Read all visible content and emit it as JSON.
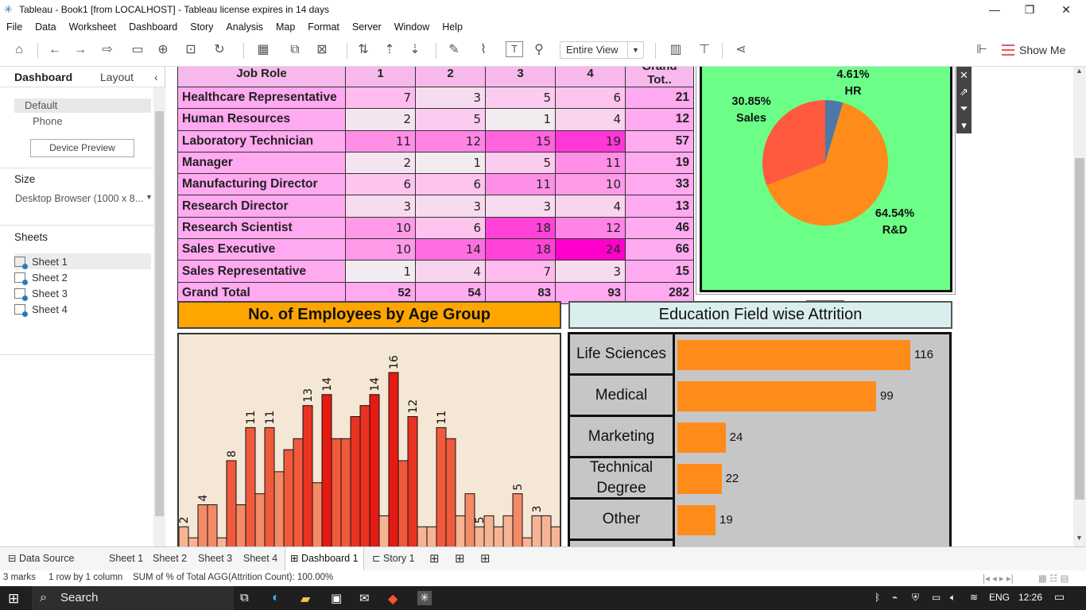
{
  "window": {
    "title": "Tableau - Book1 [from LOCALHOST] - Tableau license expires in 14 days",
    "minimize": "—",
    "restore": "❐",
    "close": "✕"
  },
  "menu": [
    "File",
    "Data",
    "Worksheet",
    "Dashboard",
    "Story",
    "Analysis",
    "Map",
    "Format",
    "Server",
    "Window",
    "Help"
  ],
  "toolbar": {
    "fit_value": "Entire View",
    "show_me": "Show Me"
  },
  "left_panel": {
    "tab_dashboard": "Dashboard",
    "tab_layout": "Layout",
    "collapse": "‹",
    "device_default": "Default",
    "device_phone": "Phone",
    "device_preview_button": "Device Preview",
    "size_title": "Size",
    "size_value": "Desktop Browser (1000 x 8...",
    "sheets_title": "Sheets",
    "sheets": [
      "Sheet 1",
      "Sheet 2",
      "Sheet 3",
      "Sheet 4"
    ]
  },
  "heat_table": {
    "headers": [
      "Job Role",
      "1",
      "2",
      "3",
      "4",
      "Grand Tot.."
    ],
    "rows": [
      {
        "role": "Healthcare Representative",
        "values": [
          7,
          3,
          5,
          6
        ],
        "total": 21
      },
      {
        "role": "Human Resources",
        "values": [
          2,
          5,
          1,
          4
        ],
        "total": 12
      },
      {
        "role": "Laboratory Technician",
        "values": [
          11,
          12,
          15,
          19
        ],
        "total": 57
      },
      {
        "role": "Manager",
        "values": [
          2,
          1,
          5,
          11
        ],
        "total": 19
      },
      {
        "role": "Manufacturing Director",
        "values": [
          6,
          6,
          11,
          10
        ],
        "total": 33
      },
      {
        "role": "Research Director",
        "values": [
          3,
          3,
          3,
          4
        ],
        "total": 13
      },
      {
        "role": "Research Scientist",
        "values": [
          10,
          6,
          18,
          12
        ],
        "total": 46
      },
      {
        "role": "Sales Executive",
        "values": [
          10,
          14,
          18,
          24
        ],
        "total": 66
      },
      {
        "role": "Sales Representative",
        "values": [
          1,
          4,
          7,
          3
        ],
        "total": 15
      },
      {
        "role": "Grand Total",
        "values": [
          52,
          54,
          83,
          93
        ],
        "total": 282
      }
    ]
  },
  "pie": {
    "slices": [
      {
        "pct_label": "4.61%",
        "name": "HR",
        "value": 4.61,
        "color": "#4e79a7"
      },
      {
        "pct_label": "64.54%",
        "name": "R&D",
        "value": 64.54,
        "color": "#ff8c1a"
      },
      {
        "pct_label": "30.85%",
        "name": "Sales",
        "value": 30.85,
        "color": "#ff5a3d"
      }
    ]
  },
  "age_chart": {
    "title": "No. of Employees by Age Group"
  },
  "edu_chart": {
    "title": "Education Field wise Attrition",
    "items": [
      {
        "label": "Life Sciences",
        "value": 116
      },
      {
        "label": "Medical",
        "value": 99
      },
      {
        "label": "Marketing",
        "value": 24
      },
      {
        "label": "Technical Degree",
        "value": 22
      },
      {
        "label": "Other",
        "value": 19
      }
    ]
  },
  "chart_data": [
    {
      "type": "bar",
      "title": "No. of Employees by Age Group",
      "values": [
        2,
        1,
        4,
        4,
        1,
        8,
        4,
        11,
        5,
        11,
        7,
        9,
        10,
        13,
        6,
        14,
        10,
        10,
        12,
        13,
        14,
        3,
        16,
        8,
        12,
        2,
        2,
        11,
        10,
        3,
        5,
        2,
        3,
        2,
        3,
        5,
        1,
        3,
        3,
        2,
        2
      ],
      "data_labels": {
        "0": "2",
        "2": "4",
        "5": "8",
        "7": "11",
        "9": "11",
        "13": "13",
        "15": "14",
        "20": "14",
        "22": "16",
        "24": "12",
        "27": "11",
        "31": "5",
        "35": "5",
        "37": "3",
        "40": "2"
      }
    },
    {
      "type": "bar",
      "title": "Education Field wise Attrition",
      "categories": [
        "Life Sciences",
        "Medical",
        "Marketing",
        "Technical Degree",
        "Other"
      ],
      "values": [
        116,
        99,
        24,
        22,
        19
      ]
    },
    {
      "type": "pie",
      "categories": [
        "HR",
        "R&D",
        "Sales"
      ],
      "values": [
        4.61,
        64.54,
        30.85
      ]
    }
  ],
  "bottom_tabs": {
    "data_source": "Data Source",
    "sheets": [
      "Sheet 1",
      "Sheet 2",
      "Sheet 3",
      "Sheet 4"
    ],
    "dashboard": "Dashboard 1",
    "story": "Story 1"
  },
  "status": {
    "marks": "3 marks",
    "rows": "1 row by 1 column",
    "sum": "SUM of % of Total AGG(Attrition Count): 100.00%"
  },
  "taskbar": {
    "search": "Search",
    "lang": "ENG",
    "time": "12:26"
  }
}
